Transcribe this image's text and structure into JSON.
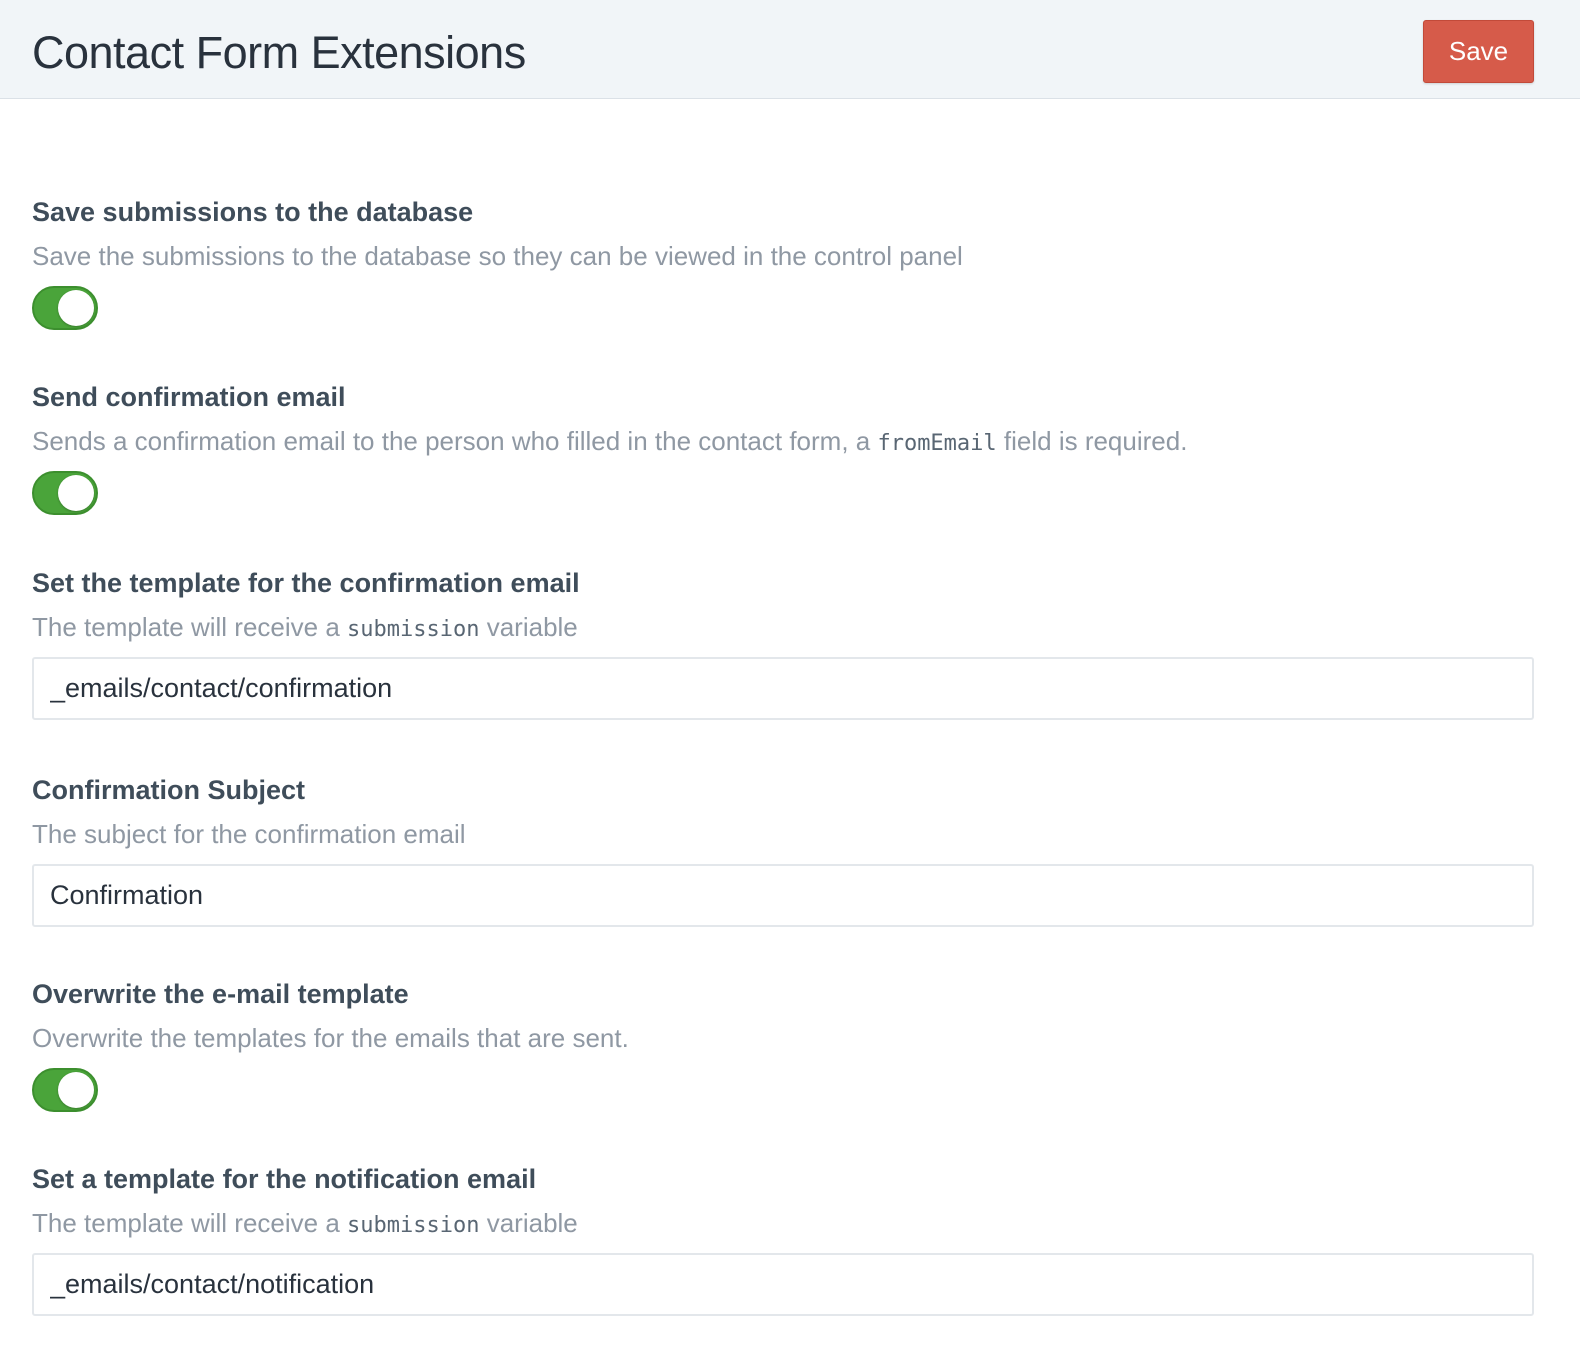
{
  "header": {
    "title": "Contact Form Extensions",
    "save_label": "Save"
  },
  "fields": [
    {
      "label": "Save submissions to the database",
      "instructions": "Save the submissions to the database so they can be viewed in the control panel",
      "type": "lightswitch",
      "on": true
    },
    {
      "label": "Send confirmation email",
      "instructions_before": "Sends a confirmation email to the person who filled in the contact form, a ",
      "instructions_code": "fromEmail",
      "instructions_after": " field is required.",
      "type": "lightswitch",
      "on": true
    },
    {
      "label": "Set the template for the confirmation email",
      "instructions_before": "The template will receive a ",
      "instructions_code": "submission",
      "instructions_after": " variable",
      "type": "text",
      "value": "_emails/contact/confirmation"
    },
    {
      "label": "Confirmation Subject",
      "instructions": "The subject for the confirmation email",
      "type": "text",
      "value": "Confirmation"
    },
    {
      "label": "Overwrite the e-mail template",
      "instructions": "Overwrite the templates for the emails that are sent.",
      "type": "lightswitch",
      "on": true
    },
    {
      "label": "Set a template for the notification email",
      "instructions_before": "The template will receive a ",
      "instructions_code": "submission",
      "instructions_after": " variable",
      "type": "text",
      "value": "_emails/contact/notification"
    }
  ],
  "colors": {
    "toggle_on": "#4aa43a",
    "save_button": "#d65b4a",
    "header_bg": "#f1f5f8"
  }
}
